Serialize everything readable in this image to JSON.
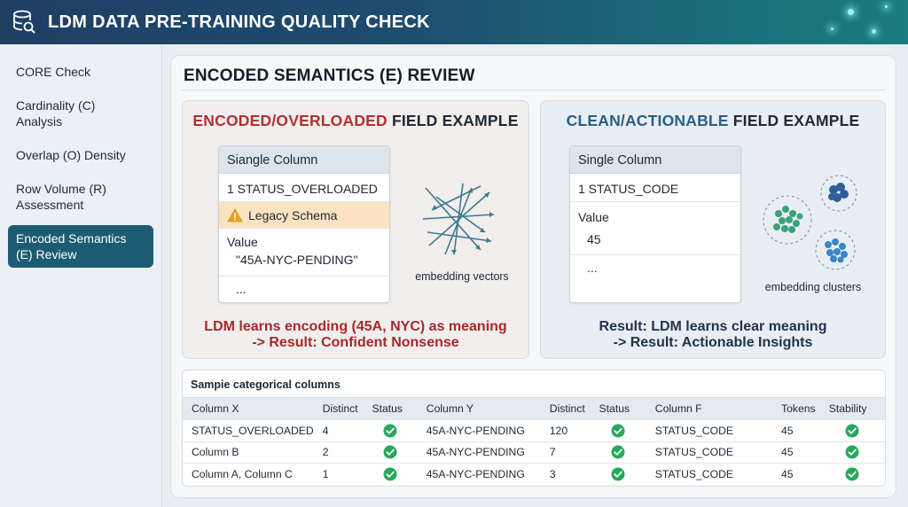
{
  "header": {
    "title": "LDM DATA PRE-TRAINING QUALITY CHECK",
    "icon": "database-search-icon"
  },
  "sidebar": {
    "items": [
      {
        "label": "CORE Check",
        "active": false
      },
      {
        "label": "Cardinality (C) Analysis",
        "active": false
      },
      {
        "label": "Overlap (O) Density",
        "active": false
      },
      {
        "label": "Row Volume (R) Assessment",
        "active": false
      },
      {
        "label": "Encoded Semantics (E) Review",
        "active": true
      }
    ]
  },
  "main": {
    "title": "ENCODED SEMANTICS (E) REVIEW",
    "left_panel": {
      "heading_accent": "ENCODED/OVERLOADED",
      "heading_rest": " FIELD EXAMPLE",
      "card_header": "Siangle Column",
      "field_row": "1 STATUS_OVERLOADED",
      "warning": "Legacy Schema",
      "value_label": "Value",
      "value": "\"45A-NYC-PENDING\"",
      "ellipsis": "...",
      "caption": "embedding vectors",
      "result_line1": "LDM learns encoding (45A, NYC) as meaning",
      "result_line2": "-> Result: Confident Nonsense"
    },
    "right_panel": {
      "heading_accent": "CLEAN/ACTIONABLE",
      "heading_rest": " FIELD EXAMPLE",
      "card_header": "Single Column",
      "field_row": "1 STATUS_CODE",
      "value_label": "Value",
      "value": "45",
      "ellipsis": "...",
      "caption": "embedding clusters",
      "result_line1": "Result: LDM learns clear meaning",
      "result_line2": "-> Result: Actionable Insights"
    },
    "table": {
      "title": "Sampie categorical columns",
      "headers": [
        "Column X",
        "Distinct",
        "Status",
        "Column Y",
        "Distinct",
        "Status",
        "Column F",
        "Tokens",
        "Stability"
      ],
      "rows": [
        [
          "STATUS_OVERLOADED",
          "4",
          "ok",
          "45A-NYC-PENDING",
          "120",
          "ok",
          "STATUS_CODE",
          "45",
          "ok"
        ],
        [
          "Column B",
          "2",
          "ok",
          "45A-NYC-PENDING",
          "7",
          "ok",
          "STATUS_CODE",
          "45",
          "ok"
        ],
        [
          "Column A, Column C",
          "1",
          "ok",
          "45A-NYC-PENDING",
          "3",
          "ok",
          "STATUS_CODE",
          "45",
          "ok"
        ]
      ]
    }
  },
  "colors": {
    "accent_red": "#b3302f",
    "accent_blue": "#2a5e88",
    "active_nav": "#1d5b73",
    "check_green": "#27a85c"
  }
}
